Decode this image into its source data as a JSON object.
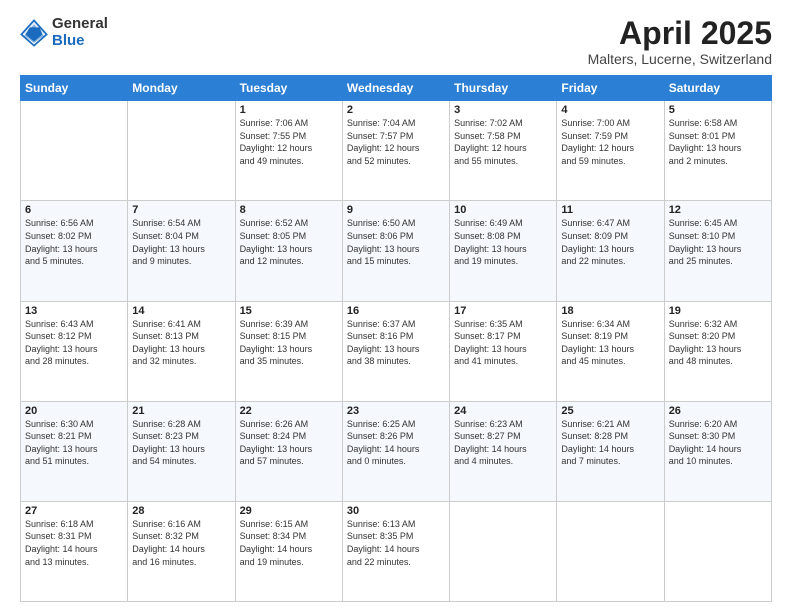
{
  "header": {
    "logo_general": "General",
    "logo_blue": "Blue",
    "month_title": "April 2025",
    "location": "Malters, Lucerne, Switzerland"
  },
  "days_of_week": [
    "Sunday",
    "Monday",
    "Tuesday",
    "Wednesday",
    "Thursday",
    "Friday",
    "Saturday"
  ],
  "weeks": [
    [
      {
        "day": "",
        "info": ""
      },
      {
        "day": "",
        "info": ""
      },
      {
        "day": "1",
        "info": "Sunrise: 7:06 AM\nSunset: 7:55 PM\nDaylight: 12 hours\nand 49 minutes."
      },
      {
        "day": "2",
        "info": "Sunrise: 7:04 AM\nSunset: 7:57 PM\nDaylight: 12 hours\nand 52 minutes."
      },
      {
        "day": "3",
        "info": "Sunrise: 7:02 AM\nSunset: 7:58 PM\nDaylight: 12 hours\nand 55 minutes."
      },
      {
        "day": "4",
        "info": "Sunrise: 7:00 AM\nSunset: 7:59 PM\nDaylight: 12 hours\nand 59 minutes."
      },
      {
        "day": "5",
        "info": "Sunrise: 6:58 AM\nSunset: 8:01 PM\nDaylight: 13 hours\nand 2 minutes."
      }
    ],
    [
      {
        "day": "6",
        "info": "Sunrise: 6:56 AM\nSunset: 8:02 PM\nDaylight: 13 hours\nand 5 minutes."
      },
      {
        "day": "7",
        "info": "Sunrise: 6:54 AM\nSunset: 8:04 PM\nDaylight: 13 hours\nand 9 minutes."
      },
      {
        "day": "8",
        "info": "Sunrise: 6:52 AM\nSunset: 8:05 PM\nDaylight: 13 hours\nand 12 minutes."
      },
      {
        "day": "9",
        "info": "Sunrise: 6:50 AM\nSunset: 8:06 PM\nDaylight: 13 hours\nand 15 minutes."
      },
      {
        "day": "10",
        "info": "Sunrise: 6:49 AM\nSunset: 8:08 PM\nDaylight: 13 hours\nand 19 minutes."
      },
      {
        "day": "11",
        "info": "Sunrise: 6:47 AM\nSunset: 8:09 PM\nDaylight: 13 hours\nand 22 minutes."
      },
      {
        "day": "12",
        "info": "Sunrise: 6:45 AM\nSunset: 8:10 PM\nDaylight: 13 hours\nand 25 minutes."
      }
    ],
    [
      {
        "day": "13",
        "info": "Sunrise: 6:43 AM\nSunset: 8:12 PM\nDaylight: 13 hours\nand 28 minutes."
      },
      {
        "day": "14",
        "info": "Sunrise: 6:41 AM\nSunset: 8:13 PM\nDaylight: 13 hours\nand 32 minutes."
      },
      {
        "day": "15",
        "info": "Sunrise: 6:39 AM\nSunset: 8:15 PM\nDaylight: 13 hours\nand 35 minutes."
      },
      {
        "day": "16",
        "info": "Sunrise: 6:37 AM\nSunset: 8:16 PM\nDaylight: 13 hours\nand 38 minutes."
      },
      {
        "day": "17",
        "info": "Sunrise: 6:35 AM\nSunset: 8:17 PM\nDaylight: 13 hours\nand 41 minutes."
      },
      {
        "day": "18",
        "info": "Sunrise: 6:34 AM\nSunset: 8:19 PM\nDaylight: 13 hours\nand 45 minutes."
      },
      {
        "day": "19",
        "info": "Sunrise: 6:32 AM\nSunset: 8:20 PM\nDaylight: 13 hours\nand 48 minutes."
      }
    ],
    [
      {
        "day": "20",
        "info": "Sunrise: 6:30 AM\nSunset: 8:21 PM\nDaylight: 13 hours\nand 51 minutes."
      },
      {
        "day": "21",
        "info": "Sunrise: 6:28 AM\nSunset: 8:23 PM\nDaylight: 13 hours\nand 54 minutes."
      },
      {
        "day": "22",
        "info": "Sunrise: 6:26 AM\nSunset: 8:24 PM\nDaylight: 13 hours\nand 57 minutes."
      },
      {
        "day": "23",
        "info": "Sunrise: 6:25 AM\nSunset: 8:26 PM\nDaylight: 14 hours\nand 0 minutes."
      },
      {
        "day": "24",
        "info": "Sunrise: 6:23 AM\nSunset: 8:27 PM\nDaylight: 14 hours\nand 4 minutes."
      },
      {
        "day": "25",
        "info": "Sunrise: 6:21 AM\nSunset: 8:28 PM\nDaylight: 14 hours\nand 7 minutes."
      },
      {
        "day": "26",
        "info": "Sunrise: 6:20 AM\nSunset: 8:30 PM\nDaylight: 14 hours\nand 10 minutes."
      }
    ],
    [
      {
        "day": "27",
        "info": "Sunrise: 6:18 AM\nSunset: 8:31 PM\nDaylight: 14 hours\nand 13 minutes."
      },
      {
        "day": "28",
        "info": "Sunrise: 6:16 AM\nSunset: 8:32 PM\nDaylight: 14 hours\nand 16 minutes."
      },
      {
        "day": "29",
        "info": "Sunrise: 6:15 AM\nSunset: 8:34 PM\nDaylight: 14 hours\nand 19 minutes."
      },
      {
        "day": "30",
        "info": "Sunrise: 6:13 AM\nSunset: 8:35 PM\nDaylight: 14 hours\nand 22 minutes."
      },
      {
        "day": "",
        "info": ""
      },
      {
        "day": "",
        "info": ""
      },
      {
        "day": "",
        "info": ""
      }
    ]
  ]
}
